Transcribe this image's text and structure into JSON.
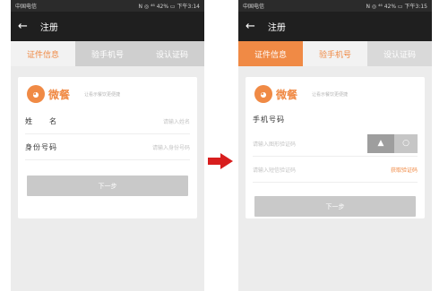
{
  "status_left": "中国电信",
  "status_right_left": "N ◎ ⁴⁶ 42% ▭ 下午3:14",
  "status_right_right": "N ◎ ⁴⁶ 42% ▭ 下午3:15",
  "nav_title": "注册",
  "tabs": [
    "证件信息",
    "验手机号",
    "设认证码"
  ],
  "brand_name": "微餐",
  "slogan": "让看示餐饮更便捷",
  "left_form": {
    "name_label": "姓　　名",
    "name_placeholder": "请输入姓名",
    "id_label": "身份号码",
    "id_placeholder": "请输入身份号码",
    "next_button": "下一步"
  },
  "right_form": {
    "phone_label": "手机号码",
    "captcha_placeholder": "请输入图形验证码",
    "sms_placeholder": "请输入短信验证码",
    "get_code": "获取验证码",
    "next_button": "下一步"
  },
  "colors": {
    "accent": "#f08a45",
    "arrow": "#d81e1e"
  }
}
